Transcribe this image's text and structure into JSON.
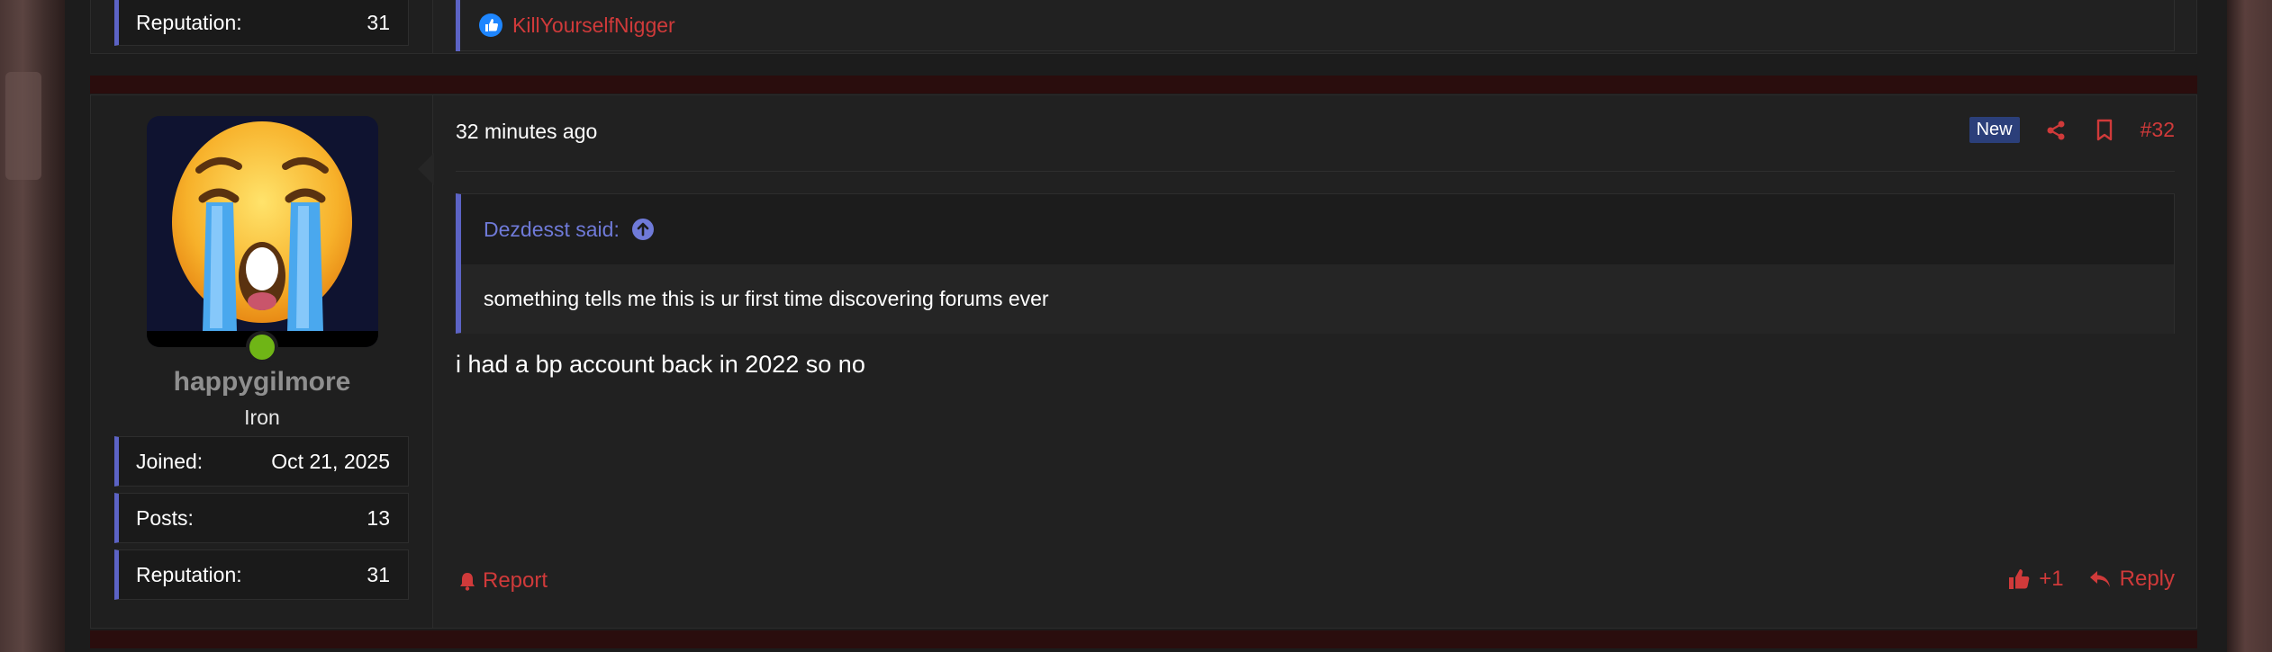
{
  "previous_post": {
    "stats": [
      {
        "label": "Reputation:",
        "value": "31"
      }
    ],
    "liked_by": "KillYourselfNigger"
  },
  "post": {
    "user": {
      "username": "happygilmore",
      "title": "Iron",
      "online_color": "#6fb516",
      "stats": [
        {
          "label": "Joined:",
          "value": "Oct 21, 2025"
        },
        {
          "label": "Posts:",
          "value": "13"
        },
        {
          "label": "Reputation:",
          "value": "31"
        }
      ]
    },
    "timestamp": "32 minutes ago",
    "badge": "New",
    "post_number": "#32",
    "quote": {
      "author_line": "Dezdesst said:",
      "text": "something tells me this is ur first time discovering forums ever"
    },
    "body": "i had a bp account back in 2022 so no",
    "report_label": "Report",
    "reaction_count": "+1",
    "reply_label": "Reply"
  },
  "colors": {
    "accent": "#d03a3a",
    "quote_accent": "#5c63c5",
    "badge_bg": "#2b3f7a",
    "separator": "#2a0d0d"
  }
}
